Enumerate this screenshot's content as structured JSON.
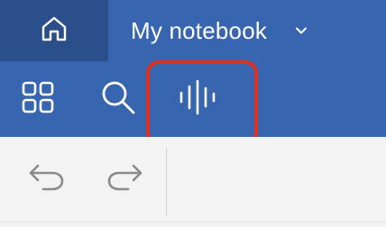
{
  "notebook": {
    "title": "My notebook"
  },
  "icons": {
    "home": "home-icon",
    "chevron": "chevron-down-icon",
    "apps": "grid-icon",
    "search": "search-icon",
    "voice": "audio-waveform-icon",
    "undo": "undo-icon",
    "redo": "redo-icon"
  },
  "colors": {
    "header_blue": "#3765b0",
    "home_tab_dark": "#2a4f8a",
    "highlight_red": "#e0301e",
    "toolbar_bg": "#f3f3f3"
  }
}
